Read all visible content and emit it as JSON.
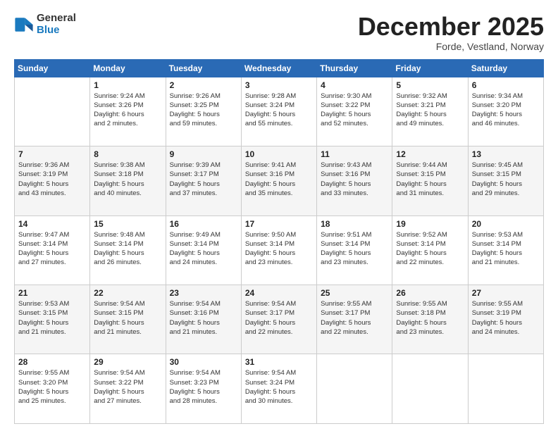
{
  "header": {
    "logo": {
      "general": "General",
      "blue": "Blue"
    },
    "title": "December 2025",
    "subtitle": "Forde, Vestland, Norway"
  },
  "weekdays": [
    "Sunday",
    "Monday",
    "Tuesday",
    "Wednesday",
    "Thursday",
    "Friday",
    "Saturday"
  ],
  "weeks": [
    [
      {
        "day": "",
        "info": ""
      },
      {
        "day": "1",
        "info": "Sunrise: 9:24 AM\nSunset: 3:26 PM\nDaylight: 6 hours\nand 2 minutes."
      },
      {
        "day": "2",
        "info": "Sunrise: 9:26 AM\nSunset: 3:25 PM\nDaylight: 5 hours\nand 59 minutes."
      },
      {
        "day": "3",
        "info": "Sunrise: 9:28 AM\nSunset: 3:24 PM\nDaylight: 5 hours\nand 55 minutes."
      },
      {
        "day": "4",
        "info": "Sunrise: 9:30 AM\nSunset: 3:22 PM\nDaylight: 5 hours\nand 52 minutes."
      },
      {
        "day": "5",
        "info": "Sunrise: 9:32 AM\nSunset: 3:21 PM\nDaylight: 5 hours\nand 49 minutes."
      },
      {
        "day": "6",
        "info": "Sunrise: 9:34 AM\nSunset: 3:20 PM\nDaylight: 5 hours\nand 46 minutes."
      }
    ],
    [
      {
        "day": "7",
        "info": "Sunrise: 9:36 AM\nSunset: 3:19 PM\nDaylight: 5 hours\nand 43 minutes."
      },
      {
        "day": "8",
        "info": "Sunrise: 9:38 AM\nSunset: 3:18 PM\nDaylight: 5 hours\nand 40 minutes."
      },
      {
        "day": "9",
        "info": "Sunrise: 9:39 AM\nSunset: 3:17 PM\nDaylight: 5 hours\nand 37 minutes."
      },
      {
        "day": "10",
        "info": "Sunrise: 9:41 AM\nSunset: 3:16 PM\nDaylight: 5 hours\nand 35 minutes."
      },
      {
        "day": "11",
        "info": "Sunrise: 9:43 AM\nSunset: 3:16 PM\nDaylight: 5 hours\nand 33 minutes."
      },
      {
        "day": "12",
        "info": "Sunrise: 9:44 AM\nSunset: 3:15 PM\nDaylight: 5 hours\nand 31 minutes."
      },
      {
        "day": "13",
        "info": "Sunrise: 9:45 AM\nSunset: 3:15 PM\nDaylight: 5 hours\nand 29 minutes."
      }
    ],
    [
      {
        "day": "14",
        "info": "Sunrise: 9:47 AM\nSunset: 3:14 PM\nDaylight: 5 hours\nand 27 minutes."
      },
      {
        "day": "15",
        "info": "Sunrise: 9:48 AM\nSunset: 3:14 PM\nDaylight: 5 hours\nand 26 minutes."
      },
      {
        "day": "16",
        "info": "Sunrise: 9:49 AM\nSunset: 3:14 PM\nDaylight: 5 hours\nand 24 minutes."
      },
      {
        "day": "17",
        "info": "Sunrise: 9:50 AM\nSunset: 3:14 PM\nDaylight: 5 hours\nand 23 minutes."
      },
      {
        "day": "18",
        "info": "Sunrise: 9:51 AM\nSunset: 3:14 PM\nDaylight: 5 hours\nand 23 minutes."
      },
      {
        "day": "19",
        "info": "Sunrise: 9:52 AM\nSunset: 3:14 PM\nDaylight: 5 hours\nand 22 minutes."
      },
      {
        "day": "20",
        "info": "Sunrise: 9:53 AM\nSunset: 3:14 PM\nDaylight: 5 hours\nand 21 minutes."
      }
    ],
    [
      {
        "day": "21",
        "info": "Sunrise: 9:53 AM\nSunset: 3:15 PM\nDaylight: 5 hours\nand 21 minutes."
      },
      {
        "day": "22",
        "info": "Sunrise: 9:54 AM\nSunset: 3:15 PM\nDaylight: 5 hours\nand 21 minutes."
      },
      {
        "day": "23",
        "info": "Sunrise: 9:54 AM\nSunset: 3:16 PM\nDaylight: 5 hours\nand 21 minutes."
      },
      {
        "day": "24",
        "info": "Sunrise: 9:54 AM\nSunset: 3:17 PM\nDaylight: 5 hours\nand 22 minutes."
      },
      {
        "day": "25",
        "info": "Sunrise: 9:55 AM\nSunset: 3:17 PM\nDaylight: 5 hours\nand 22 minutes."
      },
      {
        "day": "26",
        "info": "Sunrise: 9:55 AM\nSunset: 3:18 PM\nDaylight: 5 hours\nand 23 minutes."
      },
      {
        "day": "27",
        "info": "Sunrise: 9:55 AM\nSunset: 3:19 PM\nDaylight: 5 hours\nand 24 minutes."
      }
    ],
    [
      {
        "day": "28",
        "info": "Sunrise: 9:55 AM\nSunset: 3:20 PM\nDaylight: 5 hours\nand 25 minutes."
      },
      {
        "day": "29",
        "info": "Sunrise: 9:54 AM\nSunset: 3:22 PM\nDaylight: 5 hours\nand 27 minutes."
      },
      {
        "day": "30",
        "info": "Sunrise: 9:54 AM\nSunset: 3:23 PM\nDaylight: 5 hours\nand 28 minutes."
      },
      {
        "day": "31",
        "info": "Sunrise: 9:54 AM\nSunset: 3:24 PM\nDaylight: 5 hours\nand 30 minutes."
      },
      {
        "day": "",
        "info": ""
      },
      {
        "day": "",
        "info": ""
      },
      {
        "day": "",
        "info": ""
      }
    ]
  ]
}
